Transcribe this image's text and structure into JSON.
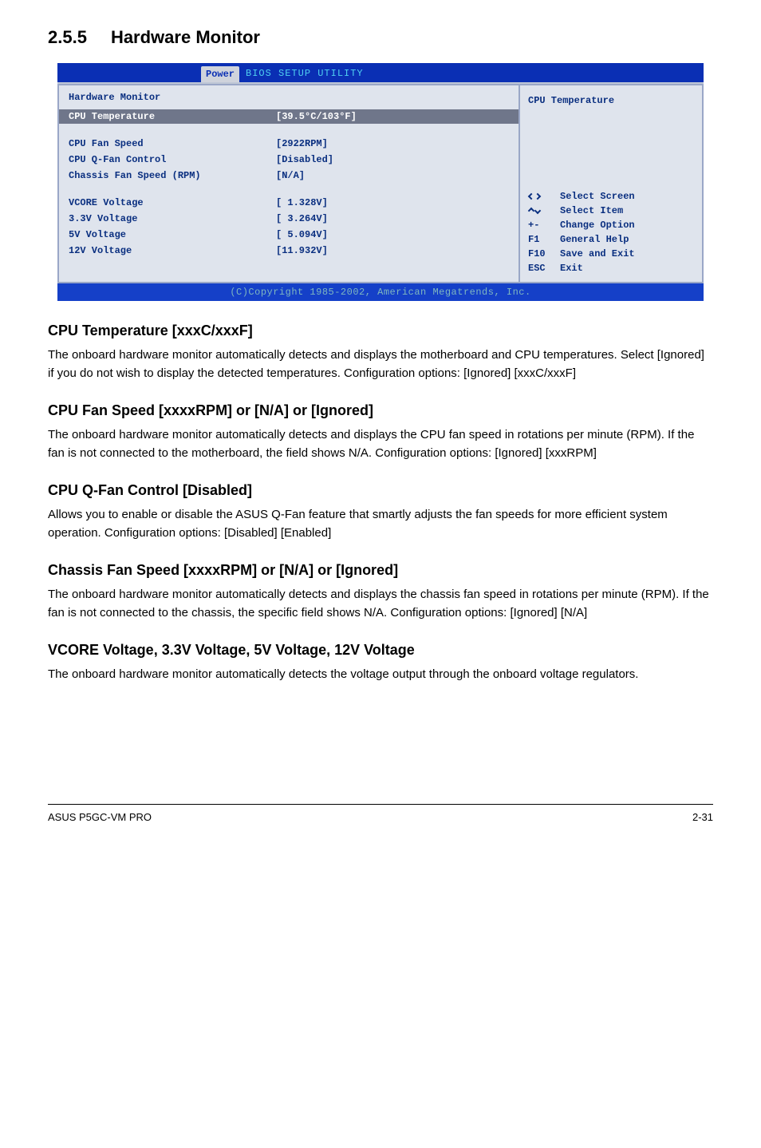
{
  "section": {
    "number": "2.5.5",
    "title": "Hardware Monitor"
  },
  "bios": {
    "tab": "Power",
    "utility_title": "BIOS SETUP UTILITY",
    "panel_title": "Hardware Monitor",
    "highlight": {
      "label": "CPU Temperature",
      "value": "[39.5°C/103°F]"
    },
    "fields": [
      {
        "label": "CPU Fan Speed",
        "value": "[2922RPM]"
      },
      {
        "label": "CPU Q-Fan Control",
        "value": "[Disabled]"
      },
      {
        "label": "Chassis Fan Speed (RPM)",
        "value": "[N/A]"
      }
    ],
    "voltages": [
      {
        "label": "VCORE Voltage",
        "value": "[ 1.328V]"
      },
      {
        "label": "3.3V Voltage",
        "value": "[ 3.264V]"
      },
      {
        "label": "5V Voltage",
        "value": "[ 5.094V]"
      },
      {
        "label": "12V Voltage",
        "value": "[11.932V]"
      }
    ],
    "right_title": "CPU Temperature",
    "help": [
      {
        "key": "↔",
        "text": "Select Screen"
      },
      {
        "key": "↕",
        "text": "Select Item"
      },
      {
        "key": "+-",
        "text": "Change Option"
      },
      {
        "key": "F1",
        "text": "General Help"
      },
      {
        "key": "F10",
        "text": "Save and Exit"
      },
      {
        "key": "ESC",
        "text": "Exit"
      }
    ],
    "copyright": "(C)Copyright 1985-2002, American Megatrends, Inc."
  },
  "content": {
    "h1": "CPU Temperature [xxxC/xxxF]",
    "p1": "The onboard hardware monitor automatically detects and displays the motherboard and CPU temperatures. Select [Ignored] if you do not wish to display the detected temperatures. Configuration options: [Ignored] [xxxC/xxxF]",
    "h2": "CPU Fan Speed [xxxxRPM] or [N/A] or [Ignored]",
    "p2": "The onboard hardware monitor automatically detects and displays the CPU fan speed in rotations per minute (RPM). If the fan is not connected to the motherboard, the field shows N/A. Configuration options: [Ignored] [xxxRPM]",
    "h3": "CPU Q-Fan Control [Disabled]",
    "p3": "Allows you to enable or disable the ASUS Q-Fan feature that smartly adjusts the fan speeds for more efficient system operation. Configuration options: [Disabled] [Enabled]",
    "h4": "Chassis Fan Speed [xxxxRPM] or [N/A] or [Ignored]",
    "p4": "The onboard hardware monitor automatically detects and displays the chassis fan speed in rotations per minute (RPM). If the fan is not connected to the chassis, the specific field shows N/A. Configuration options: [Ignored] [N/A]",
    "h5": "VCORE Voltage, 3.3V Voltage, 5V Voltage, 12V Voltage",
    "p5": "The onboard hardware monitor automatically detects the voltage output through the onboard voltage regulators."
  },
  "footer": {
    "product": "ASUS P5GC-VM PRO",
    "page": "2-31"
  }
}
